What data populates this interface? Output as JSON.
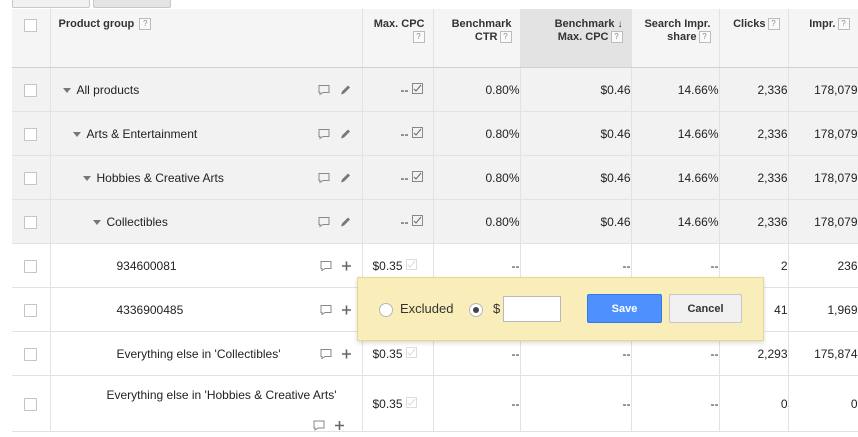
{
  "headers": {
    "product_group": "Product group",
    "max_cpc": "Max. CPC",
    "benchmark_ctr_l1": "Benchmark",
    "benchmark_ctr_l2": "CTR",
    "benchmark_max_cpc_l1": "Benchmark",
    "benchmark_max_cpc_l2": "Max. CPC",
    "search_impr_l1": "Search Impr.",
    "search_impr_l2": "share",
    "clicks": "Clicks",
    "impr": "Impr.",
    "help": "?",
    "sort_arrow": "↓"
  },
  "rows": [
    {
      "name": "All products",
      "cpc": "--",
      "ctr": "0.80%",
      "bench": "$0.46",
      "share": "14.66%",
      "clicks": "2,336",
      "impr": "178,079"
    },
    {
      "name": "Arts & Entertainment",
      "cpc": "--",
      "ctr": "0.80%",
      "bench": "$0.46",
      "share": "14.66%",
      "clicks": "2,336",
      "impr": "178,079"
    },
    {
      "name": "Hobbies & Creative Arts",
      "cpc": "--",
      "ctr": "0.80%",
      "bench": "$0.46",
      "share": "14.66%",
      "clicks": "2,336",
      "impr": "178,079"
    },
    {
      "name": "Collectibles",
      "cpc": "--",
      "ctr": "0.80%",
      "bench": "$0.46",
      "share": "14.66%",
      "clicks": "2,336",
      "impr": "178,079"
    },
    {
      "name": "934600081",
      "cpc": "$0.35",
      "ctr": "--",
      "bench": "--",
      "share": "--",
      "clicks": "2",
      "impr": "236"
    },
    {
      "name": "4336900485",
      "cpc": "",
      "ctr": "",
      "bench": "",
      "share": "",
      "clicks": "41",
      "impr": "1,969"
    },
    {
      "name": "Everything else in 'Collectibles'",
      "cpc": "$0.35",
      "ctr": "--",
      "bench": "--",
      "share": "--",
      "clicks": "2,293",
      "impr": "175,874"
    },
    {
      "name": "Everything else in 'Hobbies & Creative Arts'",
      "cpc": "$0.35",
      "ctr": "--",
      "bench": "--",
      "share": "--",
      "clicks": "0",
      "impr": "0"
    }
  ],
  "popup": {
    "excluded_label": "Excluded",
    "currency": "$",
    "bid_value": "",
    "save_label": "Save",
    "cancel_label": "Cancel"
  },
  "colors": {
    "save_button": "#4d90fe",
    "popup_bg": "#f9eeba",
    "group_row_bg": "#f2f2f2"
  }
}
